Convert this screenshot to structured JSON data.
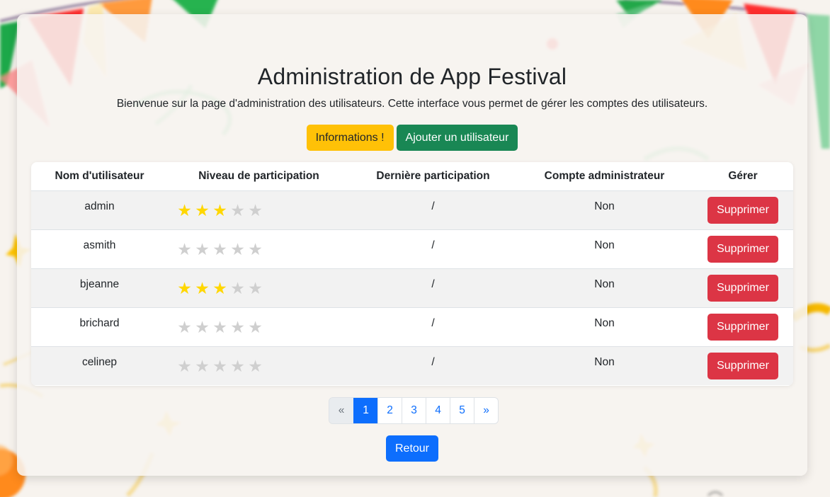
{
  "page": {
    "title": "Administration de App Festival",
    "subtitle": "Bienvenue sur la page d'administration des utilisateurs. Cette interface vous permet de gérer les comptes des utilisateurs."
  },
  "actions": {
    "info_label": "Informations !",
    "add_user_label": "Ajouter un utilisateur"
  },
  "table": {
    "headers": [
      "Nom d'utilisateur",
      "Niveau de participation",
      "Dernière participation",
      "Compte administrateur",
      "Gérer"
    ],
    "max_stars": 5,
    "rows": [
      {
        "username": "admin",
        "participation_level": 3,
        "last_participation": "/",
        "admin_account": "Non",
        "delete_label": "Supprimer"
      },
      {
        "username": "asmith",
        "participation_level": 0,
        "last_participation": "/",
        "admin_account": "Non",
        "delete_label": "Supprimer"
      },
      {
        "username": "bjeanne",
        "participation_level": 3,
        "last_participation": "/",
        "admin_account": "Non",
        "delete_label": "Supprimer"
      },
      {
        "username": "brichard",
        "participation_level": 0,
        "last_participation": "/",
        "admin_account": "Non",
        "delete_label": "Supprimer"
      },
      {
        "username": "celinep",
        "participation_level": 0,
        "last_participation": "/",
        "admin_account": "Non",
        "delete_label": "Supprimer"
      }
    ]
  },
  "pagination": {
    "prev": "«",
    "pages": [
      "1",
      "2",
      "3",
      "4",
      "5"
    ],
    "active_page": "1",
    "next": "»"
  },
  "back_label": "Retour",
  "colors": {
    "warning": "#ffc107",
    "success": "#198754",
    "danger": "#dc3545",
    "primary": "#0d6efd",
    "star_on": "#ffd700",
    "star_off": "#cfcfcf"
  }
}
